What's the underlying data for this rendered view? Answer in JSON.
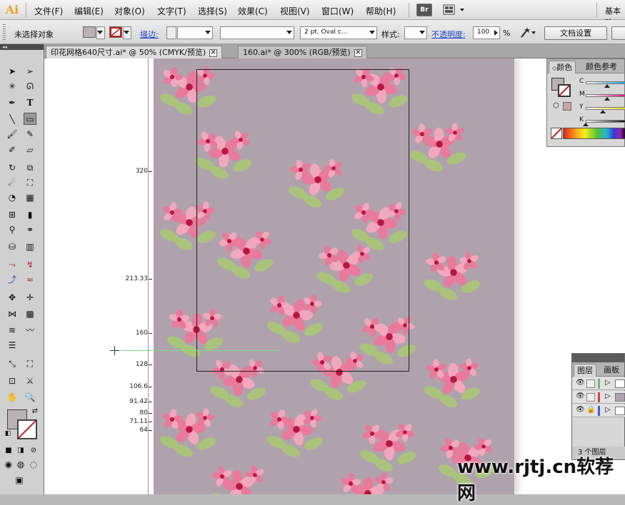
{
  "app": {
    "logo": "Ai",
    "workspace_label": "基本功"
  },
  "menu": {
    "items": [
      "文件(F)",
      "编辑(E)",
      "对象(O)",
      "文字(T)",
      "选择(S)",
      "效果(C)",
      "视图(V)",
      "窗口(W)",
      "帮助(H)"
    ],
    "bridge_label": "Br"
  },
  "control_bar": {
    "selection_status": "未选择对象",
    "stroke_label": "描边:",
    "brush_value": "2 pt. Oval c...",
    "style_label": "样式:",
    "opacity_label": "不透明度:",
    "opacity_value": "100",
    "opacity_unit": "%",
    "doc_setup_button": "文档设置",
    "fill_color": "#b9b1b5"
  },
  "tabs": [
    {
      "label": "印花网格640尺寸.ai* @ 50% (CMYK/预览)",
      "active": true
    },
    {
      "label": "160.ai* @ 300% (RGB/预览)",
      "active": false
    }
  ],
  "ruler": {
    "labels": [
      "320",
      "213.33",
      "160",
      "128",
      "106.6",
      "91.42",
      "80",
      "71.11",
      "64"
    ]
  },
  "artboard": {
    "background": "#b0a2ad"
  },
  "color_panel": {
    "tabs": [
      "颜色",
      "颜色参考"
    ],
    "sliders": [
      "C",
      "M",
      "Y",
      "K"
    ],
    "swatch_color": "#b9b1b5",
    "secondary_color": "#c9a5a8"
  },
  "layers_panel": {
    "tabs": [
      "图层",
      "画板"
    ],
    "footer": "3 个图层"
  },
  "watermark": "www.rjtj.cn软荐网"
}
